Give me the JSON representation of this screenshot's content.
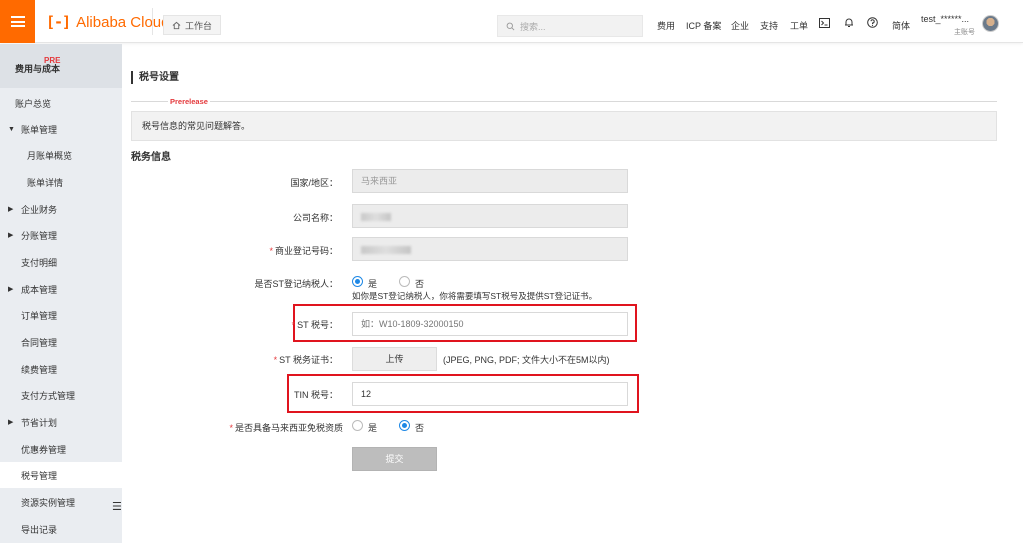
{
  "header": {
    "logo_mark": "[-]",
    "logo_text": "Alibaba Cloud",
    "workbench": "工作台",
    "search_placeholder": "搜索...",
    "nav": [
      "费用",
      "ICP 备案",
      "企业",
      "支持",
      "工单"
    ],
    "language": "简体",
    "user_name": "test_******...",
    "user_role": "主账号",
    "icons": [
      "menu-icon",
      "home-icon",
      "search-icon",
      "terminal-icon",
      "bell-icon",
      "help-icon"
    ]
  },
  "sidebar": {
    "title": "费用与成本",
    "badge": "PRE",
    "items": [
      {
        "label": "账户总览",
        "caret": ""
      },
      {
        "label": "账单管理",
        "caret": "▼"
      },
      {
        "label": "月账单概览",
        "caret": ""
      },
      {
        "label": "账单详情",
        "caret": ""
      },
      {
        "label": "企业财务",
        "caret": "▶"
      },
      {
        "label": "分账管理",
        "caret": "▶"
      },
      {
        "label": "支付明细",
        "caret": ""
      },
      {
        "label": "成本管理",
        "caret": "▶"
      },
      {
        "label": "订单管理",
        "caret": ""
      },
      {
        "label": "合同管理",
        "caret": ""
      },
      {
        "label": "续费管理",
        "caret": ""
      },
      {
        "label": "支付方式管理",
        "caret": ""
      },
      {
        "label": "节省计划",
        "caret": "▶"
      },
      {
        "label": "优惠券管理",
        "caret": ""
      },
      {
        "label": "税号管理",
        "caret": ""
      },
      {
        "label": "资源实例管理",
        "caret": ""
      },
      {
        "label": "导出记录",
        "caret": ""
      }
    ],
    "active_index": 14
  },
  "main": {
    "title": "税号设置",
    "prerelease": "Prerelease",
    "notice": "税号信息的常见问题解答。",
    "section": "税务信息",
    "form": {
      "country_label": "国家/地区：",
      "country_value": "马来西亚",
      "company_label": "公司名称：",
      "reg_label": "商业登记号码：",
      "st_reg_label": "是否ST登记纳税人：",
      "yes": "是",
      "no": "否",
      "st_hint": "如你是ST登记纳税人，你将需要填写ST税号及提供ST登记证书。",
      "st_tax_label": "ST 税号：",
      "st_tax_placeholder": "如：W10-1809-32000150",
      "st_cert_label": "ST 税务证书：",
      "upload_label": "上传",
      "upload_hint": "(JPEG, PNG, PDF; 文件大小不在5M以内)",
      "tin_label": "TIN 税号：",
      "tin_value": "12",
      "exempt_label": "是否具备马来西亚免税资质",
      "submit_label": "提交",
      "st_registered": "是",
      "tax_exempt": "否"
    }
  }
}
